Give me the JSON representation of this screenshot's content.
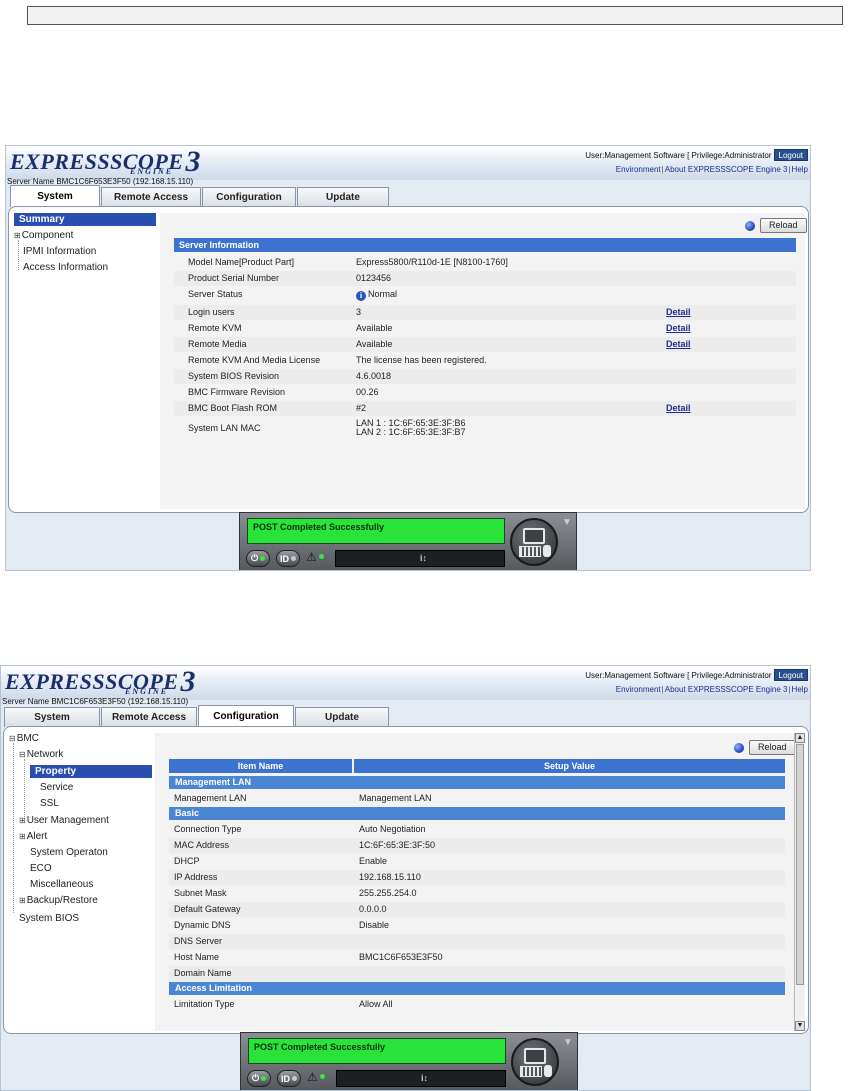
{
  "header": {
    "logo_main": "EXPRESSSCOPE",
    "logo_num": "3",
    "logo_sub": "ENGINE",
    "user_line": "User:Management Software [ Privilege:Administrator ]",
    "logout": "Logout",
    "link_environment": "Environment",
    "link_about": "About EXPRESSSCOPE Engine 3",
    "link_help": "Help",
    "server_name": "Server Name BMC1C6F653E3F50 (192.168.15.110)"
  },
  "tabs": [
    "System",
    "Remote Access",
    "Configuration",
    "Update"
  ],
  "reload": "Reload",
  "screen1": {
    "active_tab": "System",
    "sidebar": {
      "summary": "Summary",
      "component": "Component",
      "ipmi": "IPMI Information",
      "access": "Access Information"
    },
    "section_title": "Server Information",
    "rows": [
      {
        "k": "Model Name[Product Part]",
        "v": "Express5800/R110d-1E [N8100-1760]",
        "d": ""
      },
      {
        "k": "Product Serial Number",
        "v": "0123456",
        "d": ""
      },
      {
        "k": "Server Status",
        "v": "Normal",
        "d": ""
      },
      {
        "k": "Login users",
        "v": "3",
        "d": "Detail"
      },
      {
        "k": "Remote KVM",
        "v": "Available",
        "d": "Detail"
      },
      {
        "k": "Remote Media",
        "v": "Available",
        "d": "Detail"
      },
      {
        "k": "Remote KVM And Media License",
        "v": "The license has been registered.",
        "d": ""
      },
      {
        "k": "System BIOS Revision",
        "v": "4.6.0018",
        "d": ""
      },
      {
        "k": "BMC Firmware Revision",
        "v": "00.26",
        "d": ""
      },
      {
        "k": "BMC Boot Flash ROM",
        "v": "#2",
        "d": "Detail"
      }
    ],
    "lan_label": "System LAN MAC",
    "lan1": "LAN 1 : 1C:6F:65:3E:3F:B6",
    "lan2": "LAN 2 : 1C:6F:65:3E:3F:B7"
  },
  "screen2": {
    "active_tab": "Configuration",
    "sidebar": {
      "bmc": "BMC",
      "network": "Network",
      "property": "Property",
      "service": "Service",
      "ssl": "SSL",
      "user_mgmt": "User Management",
      "alert": "Alert",
      "sys_op": "System Operaton",
      "eco": "ECO",
      "misc": "Miscellaneous",
      "backup": "Backup/Restore",
      "bios": "System BIOS"
    },
    "col_item": "Item Name",
    "col_value": "Setup Value",
    "sec_mgmt": "Management LAN",
    "mgmt_rows": [
      {
        "k": "Management LAN",
        "v": "Management LAN"
      }
    ],
    "sec_basic": "Basic",
    "basic_rows": [
      {
        "k": "Connection Type",
        "v": "Auto Negotiation"
      },
      {
        "k": "MAC Address",
        "v": "1C:6F:65:3E:3F:50"
      },
      {
        "k": "DHCP",
        "v": "Enable"
      },
      {
        "k": "IP Address",
        "v": "192.168.15.110"
      },
      {
        "k": "Subnet Mask",
        "v": "255.255.254.0"
      },
      {
        "k": "Default Gateway",
        "v": "0.0.0.0"
      },
      {
        "k": "Dynamic DNS",
        "v": "Disable"
      },
      {
        "k": "DNS Server",
        "v": ""
      },
      {
        "k": "Host Name",
        "v": "BMC1C6F653E3F50"
      },
      {
        "k": "Domain Name",
        "v": ""
      }
    ],
    "sec_access": "Access Limitation",
    "access_rows": [
      {
        "k": "Limitation Type",
        "v": "Allow All"
      }
    ]
  },
  "console": {
    "status": "POST Completed Successfully",
    "power_icon": "power-icon",
    "id_label": "ID",
    "warning_icon": "warning-triangle-icon"
  },
  "colors": {
    "accent_blue": "#3b73cf",
    "sidebar_sel": "#2a4eb0",
    "status_green": "#29e33a"
  }
}
